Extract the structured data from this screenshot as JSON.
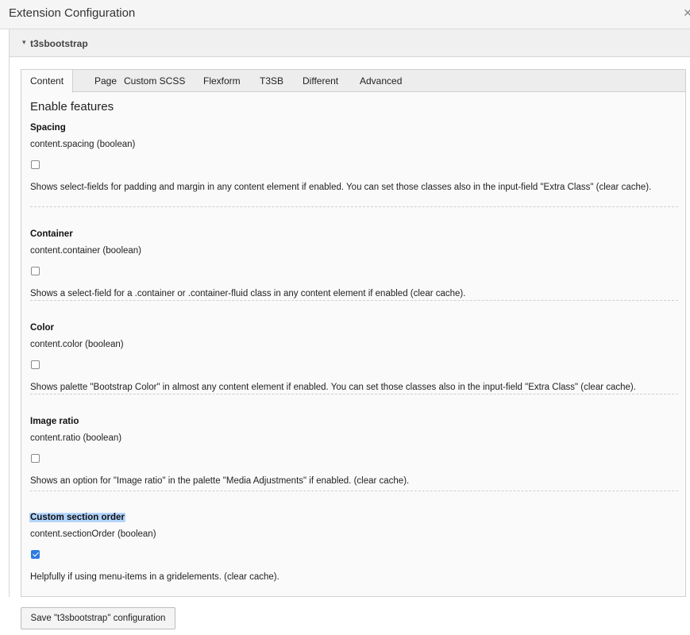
{
  "header": {
    "title": "Extension Configuration",
    "close_glyph": "✕"
  },
  "extension": {
    "caret_glyph": "▾",
    "name": "t3sbootstrap"
  },
  "tabs": [
    {
      "label": "Content",
      "active": true
    },
    {
      "label": "Page"
    },
    {
      "label": "Custom SCSS"
    },
    {
      "label": "Flexform"
    },
    {
      "label": "T3SB"
    },
    {
      "label": "Different"
    },
    {
      "label": "Advanced"
    }
  ],
  "content": {
    "heading": "Enable features",
    "settings": [
      {
        "title": "Spacing",
        "key": "content.spacing (boolean)",
        "checked": false,
        "description": "Shows select-fields for padding and margin in any content element if enabled. You can set those classes also in the input-field \"Extra Class\" (clear cache)."
      },
      {
        "title": "Container",
        "key": "content.container (boolean)",
        "checked": false,
        "description": "Shows a select-field for a .container or .container-fluid class in any content element if enabled (clear cache)."
      },
      {
        "title": "Color",
        "key": "content.color (boolean)",
        "checked": false,
        "description": "Shows palette \"Bootstrap Color\" in almost any content element if enabled. You can set those classes also in the input-field \"Extra Class\" (clear cache)."
      },
      {
        "title": "Image ratio",
        "key": "content.ratio (boolean)",
        "checked": false,
        "description": "Shows an option for \"Image ratio\" in the palette \"Media Adjustments\" if enabled. (clear cache)."
      },
      {
        "title": "Custom section order",
        "key": "content.sectionOrder (boolean)",
        "checked": true,
        "description": "Helpfully if using menu-items in a gridelements. (clear cache)."
      }
    ]
  },
  "save_button_label": "Save \"t3sbootstrap\" configuration",
  "colors": {
    "accent": "#2d7be0",
    "highlight": "#b3d4fd"
  }
}
